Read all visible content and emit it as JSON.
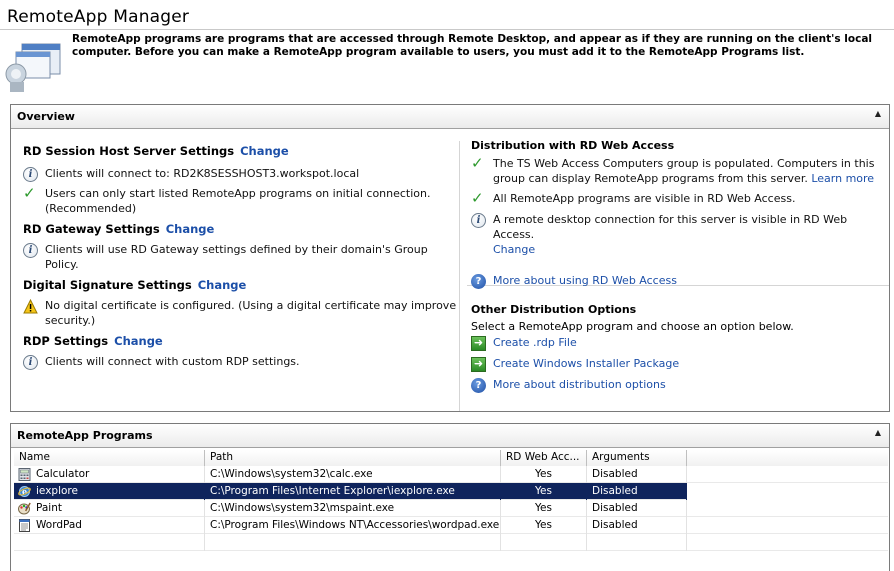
{
  "window": {
    "title": "RemoteApp Manager"
  },
  "intro": {
    "text": "RemoteApp programs are programs that are accessed through Remote Desktop, and appear as if they are running on the client's local computer. Before you can make a RemoteApp program available to users, you must add it to the RemoteApp Programs list."
  },
  "overview": {
    "title": "Overview",
    "rdsh": {
      "title": "RD Session Host Server Settings",
      "change": "Change",
      "items": [
        {
          "icon": "info-icon",
          "text": "Clients will connect to: RD2K8SESSHOST3.workspot.local"
        },
        {
          "icon": "check-icon",
          "text": "Users can only start listed RemoteApp programs on initial connection. (Recommended)"
        }
      ]
    },
    "gateway": {
      "title": "RD Gateway Settings",
      "change": "Change",
      "items": [
        {
          "icon": "info-icon",
          "text": "Clients will use RD Gateway settings defined by their domain's Group Policy."
        }
      ]
    },
    "signature": {
      "title": "Digital Signature Settings",
      "change": "Change",
      "items": [
        {
          "icon": "warning-icon",
          "text": "No digital certificate is configured. (Using a digital certificate may improve security.)"
        }
      ]
    },
    "rdp": {
      "title": "RDP Settings",
      "change": "Change",
      "items": [
        {
          "icon": "info-icon",
          "text": "Clients will connect with custom RDP settings."
        }
      ]
    },
    "distribution": {
      "title": "Distribution with RD Web Access",
      "item1": "The TS Web Access Computers group is populated.  Computers in this group can display RemoteApp programs from this server.",
      "item1_link": "Learn more",
      "item2": "All RemoteApp programs are visible in RD Web Access.",
      "item3": "A remote desktop connection for this server is visible in RD Web Access.",
      "item3_link": "Change",
      "more_link": "More about using RD Web Access"
    },
    "other": {
      "title": "Other Distribution Options",
      "desc": "Select a RemoteApp program and choose an option below.",
      "create_rdp": "Create .rdp File",
      "create_msi": "Create Windows Installer Package",
      "more": "More about distribution options"
    }
  },
  "programs": {
    "title": "RemoteApp Programs",
    "columns": [
      "Name",
      "Path",
      "RD Web Acc...",
      "Arguments"
    ],
    "rows": [
      {
        "name": "Calculator",
        "path": "C:\\Windows\\system32\\calc.exe",
        "web": "Yes",
        "args": "Disabled",
        "icon": "calculator-icon",
        "selected": false
      },
      {
        "name": "iexplore",
        "path": "C:\\Program Files\\Internet Explorer\\iexplore.exe",
        "web": "Yes",
        "args": "Disabled",
        "icon": "ie-icon",
        "selected": true
      },
      {
        "name": "Paint",
        "path": "C:\\Windows\\system32\\mspaint.exe",
        "web": "Yes",
        "args": "Disabled",
        "icon": "paint-icon",
        "selected": false
      },
      {
        "name": "WordPad",
        "path": "C:\\Program Files\\Windows NT\\Accessories\\wordpad.exe",
        "web": "Yes",
        "args": "Disabled",
        "icon": "wordpad-icon",
        "selected": false
      }
    ]
  },
  "colors": {
    "link": "#1c4fa8",
    "selection": "#0f245c",
    "check": "#2e9a2e"
  }
}
